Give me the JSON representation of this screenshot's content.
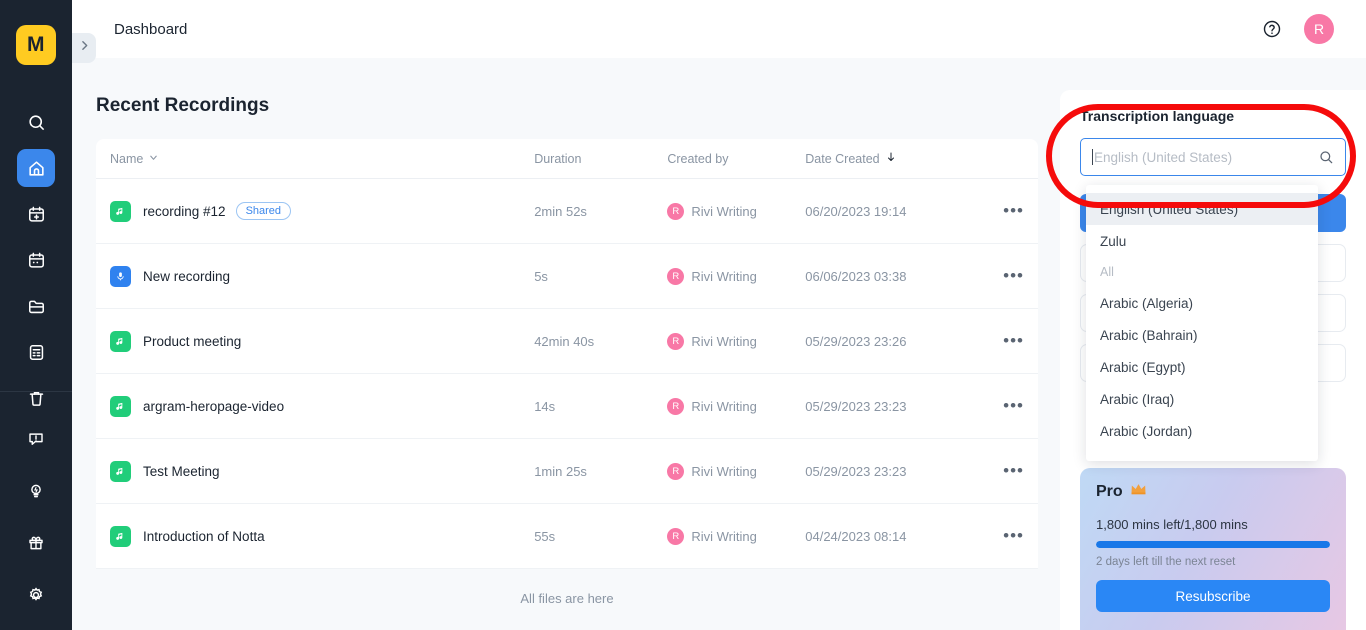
{
  "sidebar": {
    "logo": "M",
    "items": [
      {
        "name": "search",
        "icon": "search-icon",
        "active": false
      },
      {
        "name": "home",
        "icon": "home-icon",
        "active": true
      },
      {
        "name": "new-note",
        "icon": "calendar-plus-icon",
        "active": false
      },
      {
        "name": "calendar",
        "icon": "calendar-icon",
        "active": false
      },
      {
        "name": "folder",
        "icon": "folder-icon",
        "active": false
      },
      {
        "name": "notes",
        "icon": "note-icon",
        "active": false
      },
      {
        "name": "trash",
        "icon": "trash-icon",
        "active": false
      }
    ],
    "bottom_items": [
      {
        "name": "feedback",
        "icon": "feedback-icon"
      },
      {
        "name": "whats-new",
        "icon": "lightbulb-icon"
      },
      {
        "name": "gift",
        "icon": "gift-icon"
      },
      {
        "name": "settings",
        "icon": "gear-icon"
      }
    ],
    "collapse_icon": "chevron-right-icon"
  },
  "header": {
    "title": "Dashboard",
    "help_icon": "question-circle-icon",
    "avatar_initial": "R"
  },
  "main": {
    "page_title": "Recent Recordings",
    "columns": {
      "name": "Name",
      "duration": "Duration",
      "created_by": "Created by",
      "date_created": "Date Created"
    },
    "sort": {
      "name_icon": "chevron-down-icon",
      "date_icon": "arrow-down-icon"
    },
    "rows": [
      {
        "icon": "audio-file-icon",
        "icon_kind": "audio",
        "name": "recording #12",
        "badge": "Shared",
        "duration": "2min 52s",
        "created_by": "Rivi Writing",
        "avatar": "R",
        "date": "06/20/2023 19:14",
        "menu": "•••"
      },
      {
        "icon": "mic-file-icon",
        "icon_kind": "mic",
        "name": "New recording",
        "badge": "",
        "duration": "5s",
        "created_by": "Rivi Writing",
        "avatar": "R",
        "date": "06/06/2023 03:38",
        "menu": "•••"
      },
      {
        "icon": "audio-file-icon",
        "icon_kind": "audio",
        "name": "Product meeting",
        "badge": "",
        "duration": "42min 40s",
        "created_by": "Rivi Writing",
        "avatar": "R",
        "date": "05/29/2023 23:26",
        "menu": "•••"
      },
      {
        "icon": "audio-file-icon",
        "icon_kind": "audio",
        "name": "argram-heropage-video",
        "badge": "",
        "duration": "14s",
        "created_by": "Rivi Writing",
        "avatar": "R",
        "date": "05/29/2023 23:23",
        "menu": "•••"
      },
      {
        "icon": "audio-file-icon",
        "icon_kind": "audio",
        "name": "Test Meeting",
        "badge": "",
        "duration": "1min 25s",
        "created_by": "Rivi Writing",
        "avatar": "R",
        "date": "05/29/2023 23:23",
        "menu": "•••"
      },
      {
        "icon": "audio-file-icon",
        "icon_kind": "audio",
        "name": "Introduction of Notta",
        "badge": "",
        "duration": "55s",
        "created_by": "Rivi Writing",
        "avatar": "R",
        "date": "04/24/2023 08:14",
        "menu": "•••"
      }
    ],
    "footer_note": "All files are here"
  },
  "right_panel": {
    "label": "Transcription language",
    "search_placeholder": "English (United States)",
    "search_value": "",
    "search_icon": "search-icon",
    "dropdown": {
      "items": [
        {
          "label": "English (United States)",
          "selected": true,
          "group": false
        },
        {
          "label": "Zulu",
          "selected": false,
          "group": false
        },
        {
          "label": "All",
          "selected": false,
          "group": true
        },
        {
          "label": "Arabic (Algeria)",
          "selected": false,
          "group": false
        },
        {
          "label": "Arabic (Bahrain)",
          "selected": false,
          "group": false
        },
        {
          "label": "Arabic (Egypt)",
          "selected": false,
          "group": false
        },
        {
          "label": "Arabic (Iraq)",
          "selected": false,
          "group": false
        },
        {
          "label": "Arabic (Jordan)",
          "selected": false,
          "group": false
        }
      ]
    },
    "pro": {
      "title": "Pro",
      "crown_icon": "crown-icon",
      "minutes": "1,800 mins left/1,800 mins",
      "progress_percent": 100,
      "reset_note": "2 days left till the next reset",
      "button": "Resubscribe"
    }
  },
  "colors": {
    "rail_bg": "#1b2430",
    "logo_yellow": "#ffcb21",
    "accent_blue": "#3b87eb",
    "avatar_pink": "#f878a6",
    "audio_green": "#21cd7a",
    "mic_blue": "#2f82ef",
    "annotation_red": "#f50b0b"
  }
}
